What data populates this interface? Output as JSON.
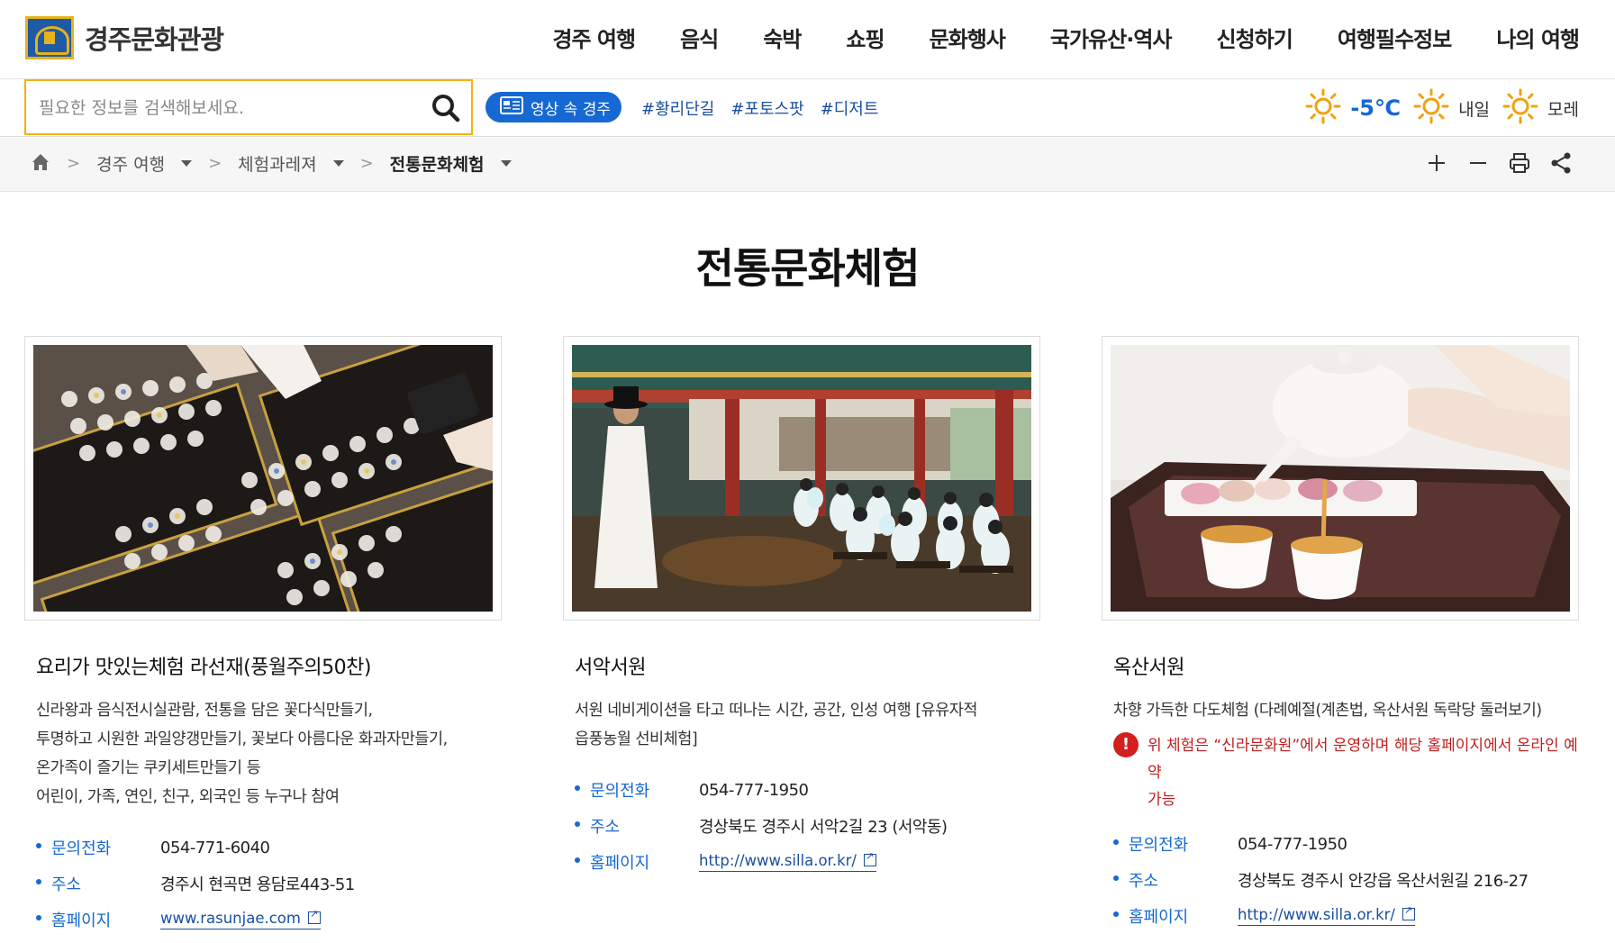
{
  "header": {
    "logo_text": "경주문화관광",
    "nav": [
      "경주 여행",
      "음식",
      "숙박",
      "쇼핑",
      "문화행사",
      "국가유산·역사",
      "신청하기",
      "여행필수정보",
      "나의 여행"
    ]
  },
  "search": {
    "placeholder": "필요한 정보를 검색해보세요.",
    "icon": "search-icon"
  },
  "video_button": {
    "label": "영상 속 경주",
    "icon": "video-icon"
  },
  "hashtags": [
    "#황리단길",
    "#포토스팟",
    "#디저트"
  ],
  "weather": {
    "today_temp": "-5℃",
    "tomorrow_label": "내일",
    "day_after_label": "모레",
    "icon": "sun-icon",
    "sun_color": "#f0a20e"
  },
  "breadcrumb": {
    "items": [
      "경주 여행",
      "체험과레져",
      "전통문화체험"
    ]
  },
  "tools": [
    "zoom-in-icon",
    "zoom-out-icon",
    "print-icon",
    "share-icon"
  ],
  "page": {
    "title": "전통문화체험"
  },
  "cards": [
    {
      "title": "요리가 맛있는체험 라선재(풍월주의50찬)",
      "desc": [
        "신라왕과 음식전시실관람, 전통을 담은 꽃다식만들기,",
        "투명하고 시원한 과일양갱만들기, 꽃보다 아름다운 화과자만들기,",
        "온가족이 즐기는 쿠키세트만들기 등",
        "어린이, 가족, 연인, 친구, 외국인 등 누구나 참여"
      ],
      "phone_label": "문의전화",
      "phone": "054-771-6040",
      "address_label": "주소",
      "address": "경주시 현곡면 용담로443-51",
      "homepage_label": "홈페이지",
      "homepage": "www.rasunjae.com"
    },
    {
      "title": "서악서원",
      "desc": [
        "서원 네비게이션을 타고 떠나는 시간, 공간, 인성 여행 [유유자적",
        "읍풍농월 선비체험]"
      ],
      "phone_label": "문의전화",
      "phone": "054-777-1950",
      "address_label": "주소",
      "address": "경상북도 경주시 서악2길 23 (서악동)",
      "homepage_label": "홈페이지",
      "homepage": "http://www.silla.or.kr/"
    },
    {
      "title": "옥산서원",
      "desc": [
        "차향 가득한 다도체험 (다례예절(계촌법, 옥산서원 독락당 둘러보기)"
      ],
      "notice": [
        "위 체험은 “신라문화원”에서 운영하며 해당 홈페이지에서 온라인 예약",
        "가능"
      ],
      "phone_label": "문의전화",
      "phone": "054-777-1950",
      "address_label": "주소",
      "address": "경상북도 경주시 안강읍 옥산서원길 216-27",
      "homepage_label": "홈페이지",
      "homepage": "http://www.silla.or.kr/"
    }
  ]
}
